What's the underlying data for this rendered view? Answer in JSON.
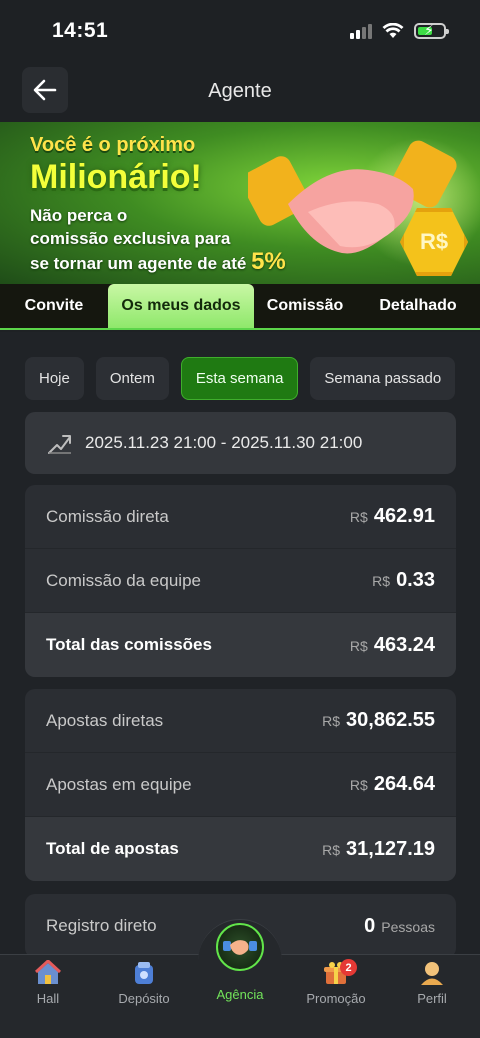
{
  "status_bar": {
    "time": "14:51"
  },
  "header": {
    "title": "Agente"
  },
  "banner": {
    "line1": "Você é o próximo",
    "line2": "Milionário!",
    "line3a": "Não perca o",
    "line3b": "comissão exclusiva para",
    "line3c": "se tornar um agente de até",
    "percent": "5%",
    "coin_text": "R$"
  },
  "tabs": [
    {
      "label": "Convite"
    },
    {
      "label": "Os meus dados"
    },
    {
      "label": "Comissão"
    },
    {
      "label": "Detalhado"
    }
  ],
  "active_tab": "Os meus dados",
  "filters": [
    {
      "label": "Hoje"
    },
    {
      "label": "Ontem"
    },
    {
      "label": "Esta semana"
    },
    {
      "label": "Semana passado"
    }
  ],
  "active_filter": "Esta semana",
  "date_range": "2025.11.23 21:00 - 2025.11.30 21:00",
  "commission": [
    {
      "label": "Comissão direta",
      "currency": "R$",
      "value": "462.91"
    },
    {
      "label": "Comissão da equipe",
      "currency": "R$",
      "value": "0.33"
    },
    {
      "label": "Total das comissões",
      "currency": "R$",
      "value": "463.24"
    }
  ],
  "bets": [
    {
      "label": "Apostas diretas",
      "currency": "R$",
      "value": "30,862.55"
    },
    {
      "label": "Apostas em equipe",
      "currency": "R$",
      "value": "264.64"
    },
    {
      "label": "Total de apostas",
      "currency": "R$",
      "value": "31,127.19"
    }
  ],
  "registrations": [
    {
      "label": "Registro direto",
      "value": "0",
      "unit": "Pessoas"
    }
  ],
  "nav": [
    {
      "label": "Hall",
      "icon": "house-icon"
    },
    {
      "label": "Depósito",
      "icon": "wallet-icon"
    },
    {
      "label": "Agência",
      "icon": "handshake-icon"
    },
    {
      "label": "Promoção",
      "icon": "gift-icon",
      "badge": "2"
    },
    {
      "label": "Perfil",
      "icon": "person-icon"
    }
  ],
  "colors": {
    "accent": "#72e35a",
    "active_filter": "#1f7a12",
    "tab_active": "#8fe86b"
  }
}
